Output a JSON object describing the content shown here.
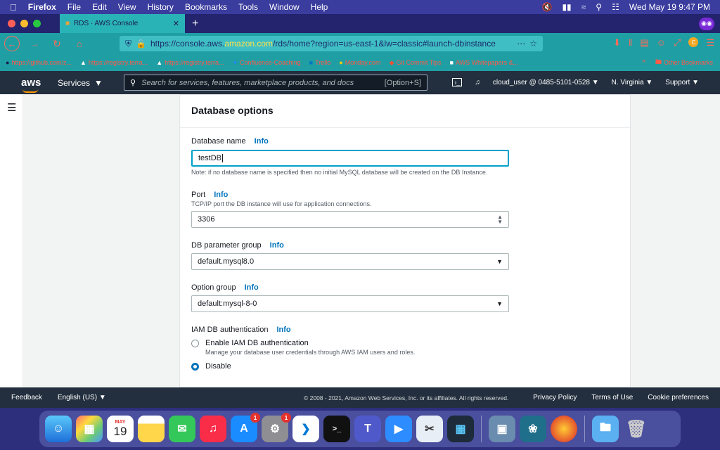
{
  "menubar": {
    "app": "Firefox",
    "items": [
      "File",
      "Edit",
      "View",
      "History",
      "Bookmarks",
      "Tools",
      "Window",
      "Help"
    ],
    "datetime": "Wed May 19  9:47 PM"
  },
  "browser": {
    "tab_title": "RDS · AWS Console",
    "url_prefix": "https://console.aws.",
    "url_domain": "amazon.com",
    "url_rest": "/rds/home?region=us-east-1&lw=classic#launch-dbinstance",
    "bookmarks": [
      "https://github.com/z...",
      "https://registry.terra...",
      "https://registry.terra...",
      "Confluence-Coaching",
      "Trello",
      "Monday.com",
      "Git Commit Tips",
      "AWS Whitepapers &..."
    ],
    "other_bookmarks": "Other Bookmarks"
  },
  "aws": {
    "logo": "aws",
    "services": "Services",
    "search_placeholder": "Search for services, features, marketplace products, and docs",
    "search_shortcut": "[Option+S]",
    "account": "cloud_user @ 0485-5101-0528",
    "region": "N. Virginia",
    "support": "Support"
  },
  "form": {
    "section_title": "Database options",
    "info": "Info",
    "db_name": {
      "label": "Database name",
      "value": "testDB",
      "note": "Note: if no database name is specified then no initial MySQL database will be created on the DB Instance."
    },
    "port": {
      "label": "Port",
      "hint": "TCP/IP port the DB instance will use for application connections.",
      "value": "3306"
    },
    "param_group": {
      "label": "DB parameter group",
      "value": "default.mysql8.0"
    },
    "option_group": {
      "label": "Option group",
      "value": "default:mysql-8-0"
    },
    "iam": {
      "label": "IAM DB authentication",
      "enable_label": "Enable IAM DB authentication",
      "enable_desc": "Manage your database user credentials through AWS IAM users and roles.",
      "disable_label": "Disable",
      "selected": "disable"
    }
  },
  "footer": {
    "feedback": "Feedback",
    "language": "English (US)",
    "copyright": "© 2008 - 2021, Amazon Web Services, Inc. or its affiliates. All rights reserved.",
    "links": [
      "Privacy Policy",
      "Terms of Use",
      "Cookie preferences"
    ]
  },
  "dock": {
    "calendar_month": "MAY",
    "calendar_day": "19",
    "appstore_badge": "1",
    "settings_badge": "1"
  },
  "colors": {
    "aws_nav": "#232f3e",
    "link": "#0073bb",
    "focus": "#00a1c9",
    "browser_accent": "#1f9fa4"
  }
}
